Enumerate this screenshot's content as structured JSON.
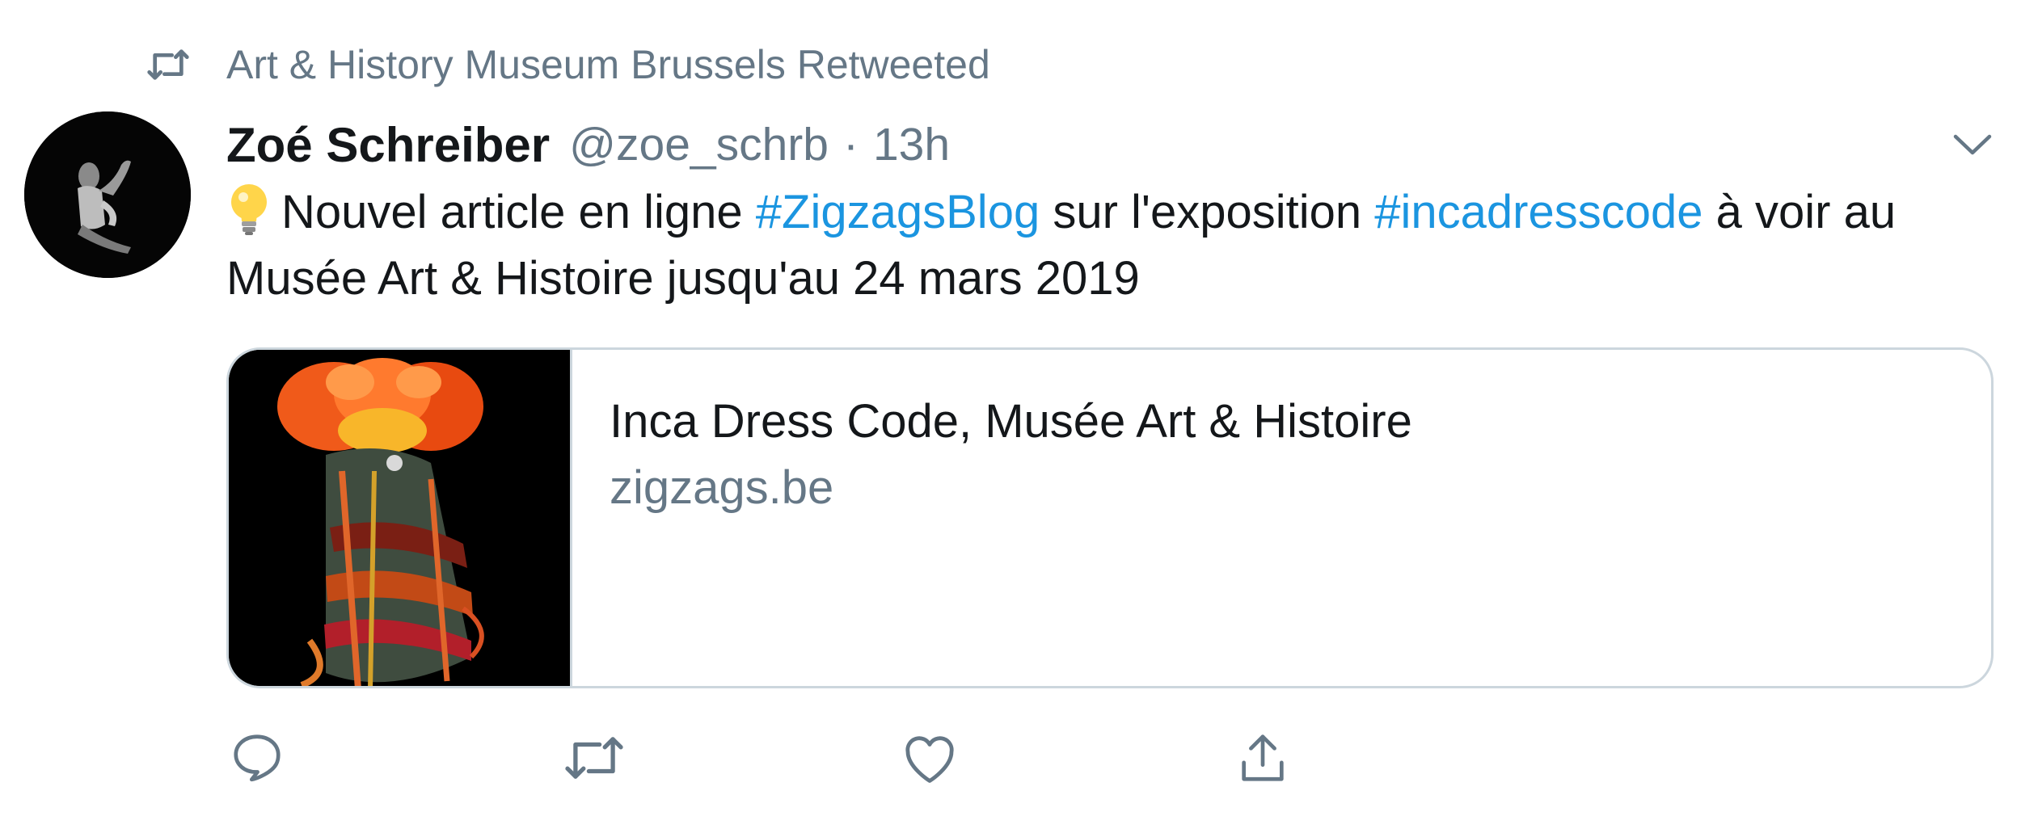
{
  "retweet_context": {
    "icon": "retweet-icon",
    "text": "Art & History Museum Brussels Retweeted"
  },
  "tweet": {
    "author": {
      "display_name": "Zoé Schreiber",
      "handle": "@zoe_schrb",
      "separator": "·",
      "timestamp": "13h",
      "avatar": "avatar-photo"
    },
    "text": {
      "emoji": "light-bulb-emoji",
      "part1": "Nouvel article en ligne ",
      "hashtag1": "#ZigzagsBlog",
      "part2": " sur l'exposition ",
      "hashtag2": "#incadresscode",
      "part3": " à voir au Musée Art & Histoire jusqu'au 24 mars 2019"
    },
    "card": {
      "title": "Inca Dress Code, Musée Art & Histoire",
      "domain": "zigzags.be",
      "image": "inca-dress-photo"
    },
    "actions": [
      {
        "name": "reply",
        "icon": "reply-icon"
      },
      {
        "name": "retweet",
        "icon": "retweet-icon"
      },
      {
        "name": "like",
        "icon": "heart-icon"
      },
      {
        "name": "share",
        "icon": "share-icon"
      }
    ]
  },
  "colors": {
    "text_primary": "#14171a",
    "text_secondary": "#657786",
    "link": "#1b95e0",
    "border": "#ccd6dd"
  }
}
